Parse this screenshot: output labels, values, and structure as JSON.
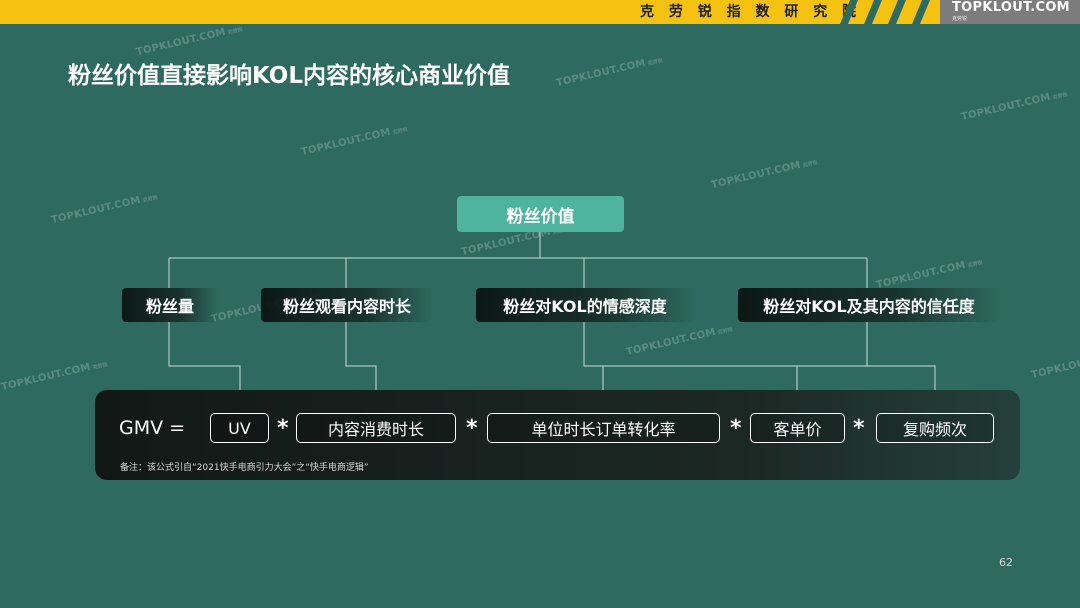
{
  "header": {
    "institute": "克 劳 锐 指 数 研 究 院",
    "logo_text": "TOPKLOUT.COM",
    "logo_sub": "克劳锐",
    "bar_color": "#f5c211"
  },
  "title": "粉丝价值直接影响KOL内容的核心商业价值",
  "watermark": {
    "text": "TOPKLOUT.COM",
    "sub": "克劳锐"
  },
  "tree": {
    "root": "粉丝价值",
    "children": [
      "粉丝量",
      "粉丝观看内容时长",
      "粉丝对KOL的情感深度",
      "粉丝对KOL及其内容的信任度"
    ]
  },
  "formula": {
    "lhs": "GMV =",
    "operator": "*",
    "factors": [
      "UV",
      "内容消费时长",
      "单位时长订单转化率",
      "客单价",
      "复购频次"
    ],
    "note": "备注：该公式引自“2021快手电商引力大会”之“快手电商逻辑”"
  },
  "page_number": "62",
  "colors": {
    "background": "#2e6a5f",
    "root_fill": "#4fb49e"
  }
}
